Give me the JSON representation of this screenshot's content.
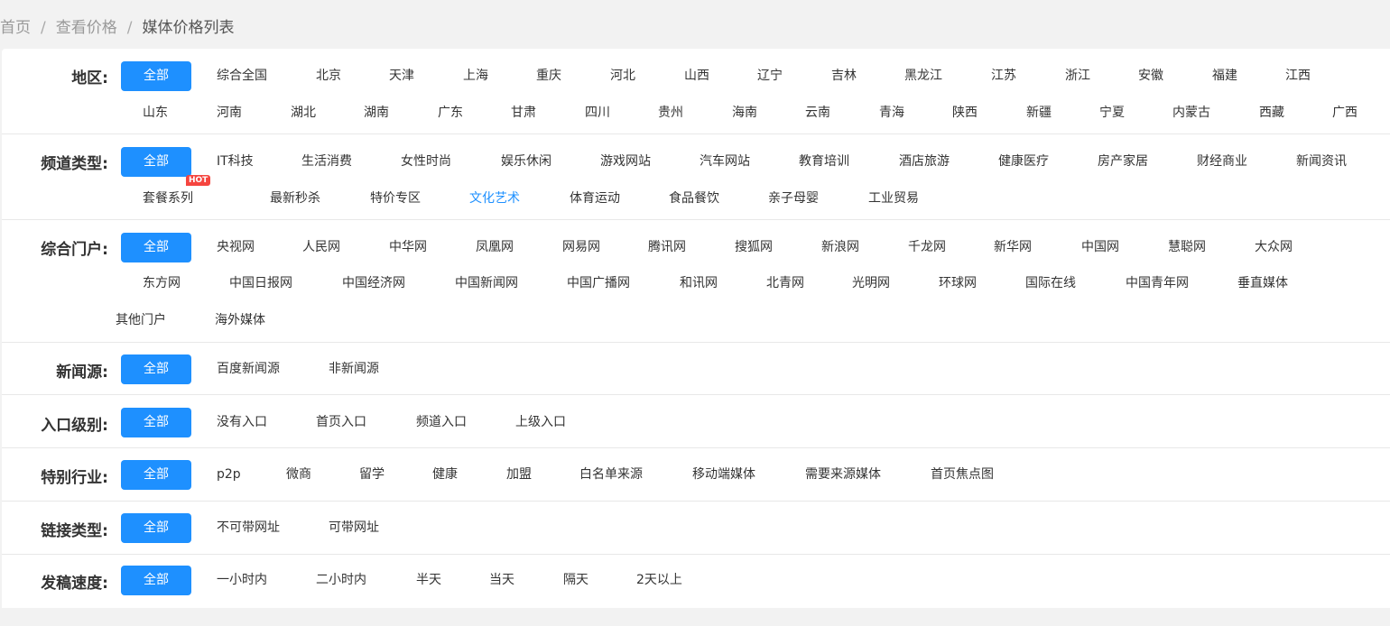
{
  "breadcrumb": {
    "home": "首页",
    "sep1": "/",
    "level2": "查看价格",
    "sep2": "/",
    "current": "媒体价格列表"
  },
  "filters": {
    "region": {
      "label": "地区:",
      "all": "全部",
      "options": [
        "综合全国",
        "北京",
        "天津",
        "上海",
        "重庆",
        "河北",
        "山西",
        "辽宁",
        "吉林",
        "黑龙江",
        "江苏",
        "浙江",
        "安徽",
        "福建",
        "江西",
        "山东",
        "河南",
        "湖北",
        "湖南",
        "广东",
        "甘肃",
        "四川",
        "贵州",
        "海南",
        "云南",
        "青海",
        "陕西",
        "新疆",
        "宁夏",
        "内蒙古",
        "西藏",
        "广西"
      ]
    },
    "channel": {
      "label": "频道类型:",
      "all": "全部",
      "hot_badge": "HOT",
      "options": [
        "IT科技",
        "生活消费",
        "女性时尚",
        "娱乐休闲",
        "游戏网站",
        "汽车网站",
        "教育培训",
        "酒店旅游",
        "健康医疗",
        "房产家居",
        "财经商业",
        "新闻资讯",
        "套餐系列",
        "最新秒杀",
        "特价专区",
        "文化艺术",
        "体育运动",
        "食品餐饮",
        "亲子母婴",
        "工业贸易"
      ]
    },
    "portal": {
      "label": "综合门户:",
      "all": "全部",
      "options": [
        "央视网",
        "人民网",
        "中华网",
        "凤凰网",
        "网易网",
        "腾讯网",
        "搜狐网",
        "新浪网",
        "千龙网",
        "新华网",
        "中国网",
        "慧聪网",
        "大众网",
        "东方网",
        "中国日报网",
        "中国经济网",
        "中国新闻网",
        "中国广播网",
        "和讯网",
        "北青网",
        "光明网",
        "环球网",
        "国际在线",
        "中国青年网",
        "垂直媒体",
        "其他门户",
        "海外媒体"
      ]
    },
    "news_source": {
      "label": "新闻源:",
      "all": "全部",
      "options": [
        "百度新闻源",
        "非新闻源"
      ]
    },
    "entry_level": {
      "label": "入口级别:",
      "all": "全部",
      "options": [
        "没有入口",
        "首页入口",
        "频道入口",
        "上级入口"
      ]
    },
    "industry": {
      "label": "特别行业:",
      "all": "全部",
      "options": [
        "p2p",
        "微商",
        "留学",
        "健康",
        "加盟",
        "白名单来源",
        "移动端媒体",
        "需要来源媒体",
        "首页焦点图"
      ]
    },
    "link_type": {
      "label": "链接类型:",
      "all": "全部",
      "options": [
        "不可带网址",
        "可带网址"
      ]
    },
    "speed": {
      "label": "发稿速度:",
      "all": "全部",
      "options": [
        "一小时内",
        "二小时内",
        "半天",
        "当天",
        "隔天",
        "2天以上"
      ]
    }
  },
  "colors": {
    "accent": "#1e90ff",
    "hot": "#f5453f",
    "active_link": "#1e90ff"
  }
}
